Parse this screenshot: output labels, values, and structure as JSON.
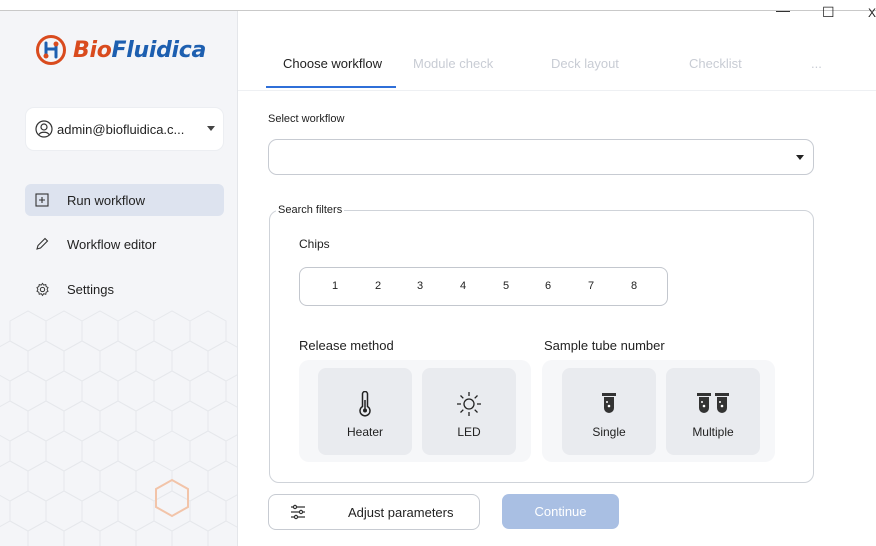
{
  "app": {
    "logo_text_left": "Bio",
    "logo_text_right": "Fluidica",
    "brand_orange": "#d94b1e",
    "brand_blue": "#1d5fb0",
    "accent": "#2f6fd8"
  },
  "window_controls": {
    "minimize": "—",
    "maximize": "☐",
    "close": "X"
  },
  "sidebar": {
    "user": "admin@biofluidica.c...",
    "items": [
      {
        "label": "Run workflow",
        "icon": "plus-square-icon",
        "active": true
      },
      {
        "label": "Workflow editor",
        "icon": "pencil-icon",
        "active": false
      },
      {
        "label": "Settings",
        "icon": "gear-icon",
        "active": false
      }
    ]
  },
  "tabs": [
    "Choose workflow",
    "Module check",
    "Deck layout",
    "Checklist",
    "..."
  ],
  "workflow": {
    "label": "Select workflow",
    "value": ""
  },
  "filters": {
    "legend": "Search filters",
    "chips_label": "Chips",
    "chips": [
      "1",
      "2",
      "3",
      "4",
      "5",
      "6",
      "7",
      "8"
    ],
    "release_label": "Release method",
    "release_options": [
      {
        "label": "Heater",
        "icon": "thermometer-icon"
      },
      {
        "label": "LED",
        "icon": "sun-icon"
      }
    ],
    "tube_label": "Sample tube number",
    "tube_options": [
      {
        "label": "Single",
        "icon": "single-tube-icon"
      },
      {
        "label": "Multiple",
        "icon": "double-tube-icon"
      }
    ]
  },
  "actions": {
    "adjust": "Adjust parameters",
    "continue": "Continue"
  }
}
